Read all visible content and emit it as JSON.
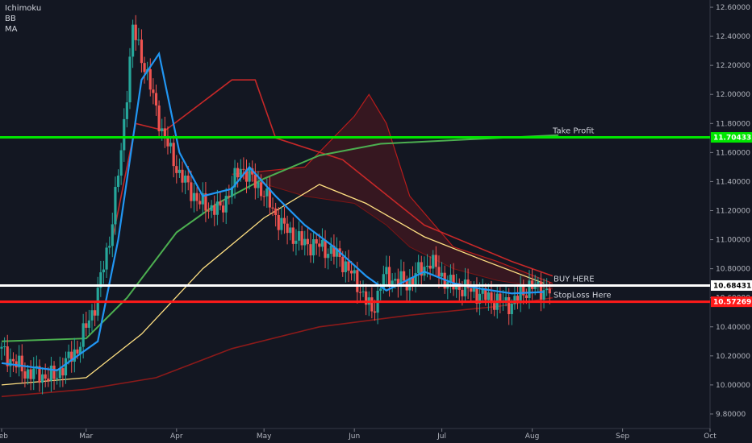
{
  "indicators": [
    "Ichimoku",
    "BB",
    "MA"
  ],
  "colors": {
    "background": "#131722",
    "grid": "#1e222d",
    "up": "#26a69a",
    "down": "#ef5350",
    "kijun_line": "#2196f3",
    "ma_green": "#4caf50",
    "ma_yellow": "#ffe082",
    "ma_darkred": "#8b1a1a",
    "cloud_red": "#b71c1c",
    "take_profit": "#00e600",
    "buy": "#ffffff",
    "stoploss": "#ff1a1a"
  },
  "chart_data": {
    "type": "candlestick",
    "x_axis": {
      "range": [
        "2020-02-01",
        "2020-10-01"
      ],
      "tick_labels": [
        "Feb",
        "Mar",
        "Apr",
        "May",
        "Jun",
        "Jul",
        "Aug",
        "Sep",
        "Oct"
      ]
    },
    "y_axis": {
      "position": "right",
      "range": [
        9.7,
        12.65
      ],
      "tick_labels": [
        "9.80000",
        "10.00000",
        "10.20000",
        "10.40000",
        "10.60000",
        "10.80000",
        "11.00000",
        "11.20000",
        "11.40000",
        "11.60000",
        "11.80000",
        "12.00000",
        "12.20000",
        "12.40000",
        "12.60000"
      ]
    },
    "grid": false,
    "price_series": [
      {
        "date": "2020-02-01",
        "close": 10.25
      },
      {
        "date": "2020-02-10",
        "close": 10.09
      },
      {
        "date": "2020-02-20",
        "close": 10.05
      },
      {
        "date": "2020-02-28",
        "close": 10.25
      },
      {
        "date": "2020-03-05",
        "close": 10.55
      },
      {
        "date": "2020-03-10",
        "close": 11.0
      },
      {
        "date": "2020-03-14",
        "close": 11.6
      },
      {
        "date": "2020-03-18",
        "close": 12.45
      },
      {
        "date": "2020-03-22",
        "close": 12.2
      },
      {
        "date": "2020-03-28",
        "close": 11.75
      },
      {
        "date": "2020-04-03",
        "close": 11.45
      },
      {
        "date": "2020-04-10",
        "close": 11.25
      },
      {
        "date": "2020-04-17",
        "close": 11.2
      },
      {
        "date": "2020-04-24",
        "close": 11.5
      },
      {
        "date": "2020-05-01",
        "close": 11.35
      },
      {
        "date": "2020-05-08",
        "close": 11.1
      },
      {
        "date": "2020-05-15",
        "close": 10.98
      },
      {
        "date": "2020-05-22",
        "close": 10.95
      },
      {
        "date": "2020-05-28",
        "close": 10.88
      },
      {
        "date": "2020-06-03",
        "close": 10.7
      },
      {
        "date": "2020-06-08",
        "close": 10.5
      },
      {
        "date": "2020-06-12",
        "close": 10.75
      },
      {
        "date": "2020-06-20",
        "close": 10.7
      },
      {
        "date": "2020-06-28",
        "close": 10.85
      },
      {
        "date": "2020-07-04",
        "close": 10.7
      },
      {
        "date": "2020-07-12",
        "close": 10.65
      },
      {
        "date": "2020-07-20",
        "close": 10.58
      },
      {
        "date": "2020-07-26",
        "close": 10.56
      },
      {
        "date": "2020-08-01",
        "close": 10.68
      },
      {
        "date": "2020-08-07",
        "close": 10.65
      }
    ],
    "overlays": {
      "kijun_blue": [
        {
          "date": "2020-02-01",
          "value": 10.15
        },
        {
          "date": "2020-02-20",
          "value": 10.1
        },
        {
          "date": "2020-03-05",
          "value": 10.3
        },
        {
          "date": "2020-03-12",
          "value": 11.0
        },
        {
          "date": "2020-03-20",
          "value": 12.1
        },
        {
          "date": "2020-03-26",
          "value": 12.28
        },
        {
          "date": "2020-04-02",
          "value": 11.6
        },
        {
          "date": "2020-04-10",
          "value": 11.3
        },
        {
          "date": "2020-04-20",
          "value": 11.35
        },
        {
          "date": "2020-04-26",
          "value": 11.5
        },
        {
          "date": "2020-05-05",
          "value": 11.3
        },
        {
          "date": "2020-05-15",
          "value": 11.1
        },
        {
          "date": "2020-05-25",
          "value": 10.95
        },
        {
          "date": "2020-06-05",
          "value": 10.75
        },
        {
          "date": "2020-06-12",
          "value": 10.65
        },
        {
          "date": "2020-06-25",
          "value": 10.78
        },
        {
          "date": "2020-07-05",
          "value": 10.7
        },
        {
          "date": "2020-07-15",
          "value": 10.66
        },
        {
          "date": "2020-07-25",
          "value": 10.63
        },
        {
          "date": "2020-08-05",
          "value": 10.64
        }
      ],
      "ma_green": [
        {
          "date": "2020-02-01",
          "value": 10.3
        },
        {
          "date": "2020-03-01",
          "value": 10.32
        },
        {
          "date": "2020-03-15",
          "value": 10.6
        },
        {
          "date": "2020-04-01",
          "value": 11.05
        },
        {
          "date": "2020-04-15",
          "value": 11.25
        },
        {
          "date": "2020-05-01",
          "value": 11.42
        },
        {
          "date": "2020-05-20",
          "value": 11.58
        },
        {
          "date": "2020-06-10",
          "value": 11.66
        },
        {
          "date": "2020-07-10",
          "value": 11.69
        },
        {
          "date": "2020-08-10",
          "value": 11.72
        }
      ],
      "ma_yellow": [
        {
          "date": "2020-02-01",
          "value": 10.0
        },
        {
          "date": "2020-03-01",
          "value": 10.05
        },
        {
          "date": "2020-03-20",
          "value": 10.35
        },
        {
          "date": "2020-04-10",
          "value": 10.8
        },
        {
          "date": "2020-05-01",
          "value": 11.15
        },
        {
          "date": "2020-05-20",
          "value": 11.38
        },
        {
          "date": "2020-06-05",
          "value": 11.25
        },
        {
          "date": "2020-06-25",
          "value": 11.02
        },
        {
          "date": "2020-07-15",
          "value": 10.86
        },
        {
          "date": "2020-08-05",
          "value": 10.7
        }
      ],
      "ma_darkred": [
        {
          "date": "2020-02-01",
          "value": 9.92
        },
        {
          "date": "2020-03-01",
          "value": 9.97
        },
        {
          "date": "2020-03-25",
          "value": 10.05
        },
        {
          "date": "2020-04-20",
          "value": 10.25
        },
        {
          "date": "2020-05-20",
          "value": 10.4
        },
        {
          "date": "2020-06-20",
          "value": 10.48
        },
        {
          "date": "2020-07-20",
          "value": 10.54
        },
        {
          "date": "2020-08-08",
          "value": 10.6
        }
      ],
      "bb_upper": [
        {
          "date": "2020-03-10",
          "value": 11.0
        },
        {
          "date": "2020-03-18",
          "value": 11.8
        },
        {
          "date": "2020-03-28",
          "value": 11.75
        },
        {
          "date": "2020-04-20",
          "value": 12.1
        },
        {
          "date": "2020-04-28",
          "value": 12.1
        },
        {
          "date": "2020-05-05",
          "value": 11.7
        },
        {
          "date": "2020-05-28",
          "value": 11.55
        },
        {
          "date": "2020-06-25",
          "value": 11.1
        },
        {
          "date": "2020-07-25",
          "value": 10.85
        },
        {
          "date": "2020-08-08",
          "value": 10.75
        }
      ],
      "cloud_span_a": [
        {
          "date": "2020-04-20",
          "value": 11.45
        },
        {
          "date": "2020-05-15",
          "value": 11.5
        },
        {
          "date": "2020-06-01",
          "value": 11.85
        },
        {
          "date": "2020-06-06",
          "value": 12.0
        },
        {
          "date": "2020-06-12",
          "value": 11.8
        },
        {
          "date": "2020-06-20",
          "value": 11.3
        },
        {
          "date": "2020-07-05",
          "value": 10.95
        },
        {
          "date": "2020-07-20",
          "value": 10.85
        },
        {
          "date": "2020-08-08",
          "value": 10.7
        }
      ],
      "cloud_span_b": [
        {
          "date": "2020-04-20",
          "value": 11.45
        },
        {
          "date": "2020-05-15",
          "value": 11.3
        },
        {
          "date": "2020-06-01",
          "value": 11.25
        },
        {
          "date": "2020-06-12",
          "value": 11.1
        },
        {
          "date": "2020-06-20",
          "value": 10.95
        },
        {
          "date": "2020-07-05",
          "value": 10.8
        },
        {
          "date": "2020-07-20",
          "value": 10.72
        },
        {
          "date": "2020-08-08",
          "value": 10.66
        }
      ]
    },
    "levels": [
      {
        "key": "take_profit",
        "label": "Take Profit",
        "value": 11.70433,
        "value_label": "11.70433",
        "color": "#00e600"
      },
      {
        "key": "buy",
        "label": "BUY HERE",
        "value": 10.68431,
        "value_label": "10.68431",
        "color": "#ffffff"
      },
      {
        "key": "stoploss",
        "label": "StopLoss Here",
        "value": 10.57269,
        "value_label": "10.57269",
        "color": "#ff1a1a"
      }
    ]
  }
}
